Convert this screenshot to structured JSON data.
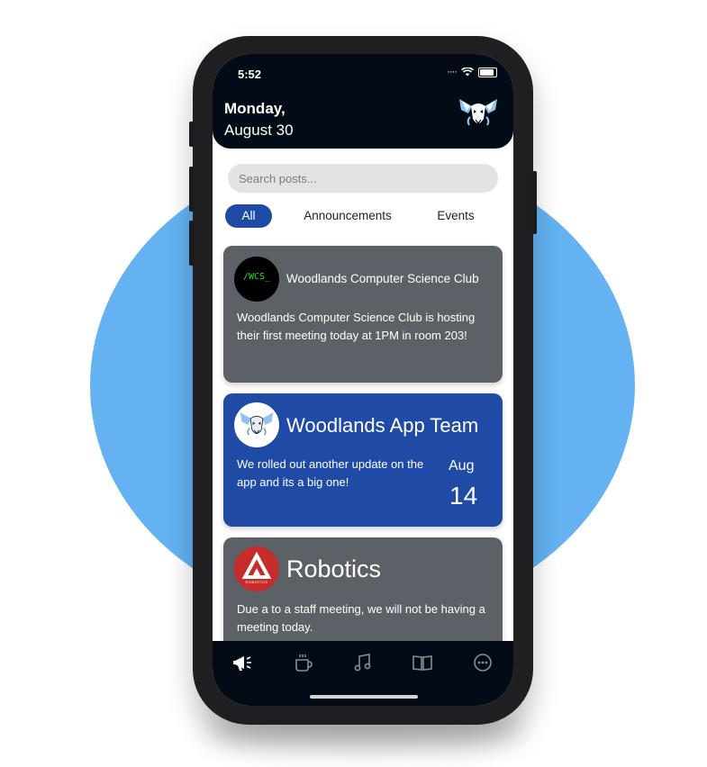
{
  "status": {
    "time": "5:52"
  },
  "header": {
    "day": "Monday,",
    "date": "August 30"
  },
  "search": {
    "placeholder": "Search posts..."
  },
  "tabs": [
    {
      "label": "All",
      "active": true
    },
    {
      "label": "Announcements",
      "active": false
    },
    {
      "label": "Events",
      "active": false
    }
  ],
  "posts": [
    {
      "club": "Woodlands Computer Science Club",
      "avatar_text": "/WCS_",
      "body": "Woodlands Computer Science Club is hosting their first meeting today at 1PM in room 203!"
    },
    {
      "club": "Woodlands App Team",
      "body": "We rolled out another update on the app and its a big one!",
      "month": "Aug",
      "day": "14"
    },
    {
      "club": "Robotics",
      "avatar_text": "ROBOTICS",
      "body": "Due a to a staff meeting, we will not be having a meeting today."
    }
  ],
  "navbar": {
    "items": [
      "megaphone-icon",
      "coffee-icon",
      "music-icon",
      "book-icon",
      "more-icon"
    ]
  },
  "colors": {
    "background_circle": "#64b2f1",
    "header": "#030c16",
    "accent_blue": "#1f4aa5",
    "card_grey": "#5c6167",
    "wcs_green": "#2fdc2f",
    "robotics_red": "#c62c2c"
  }
}
